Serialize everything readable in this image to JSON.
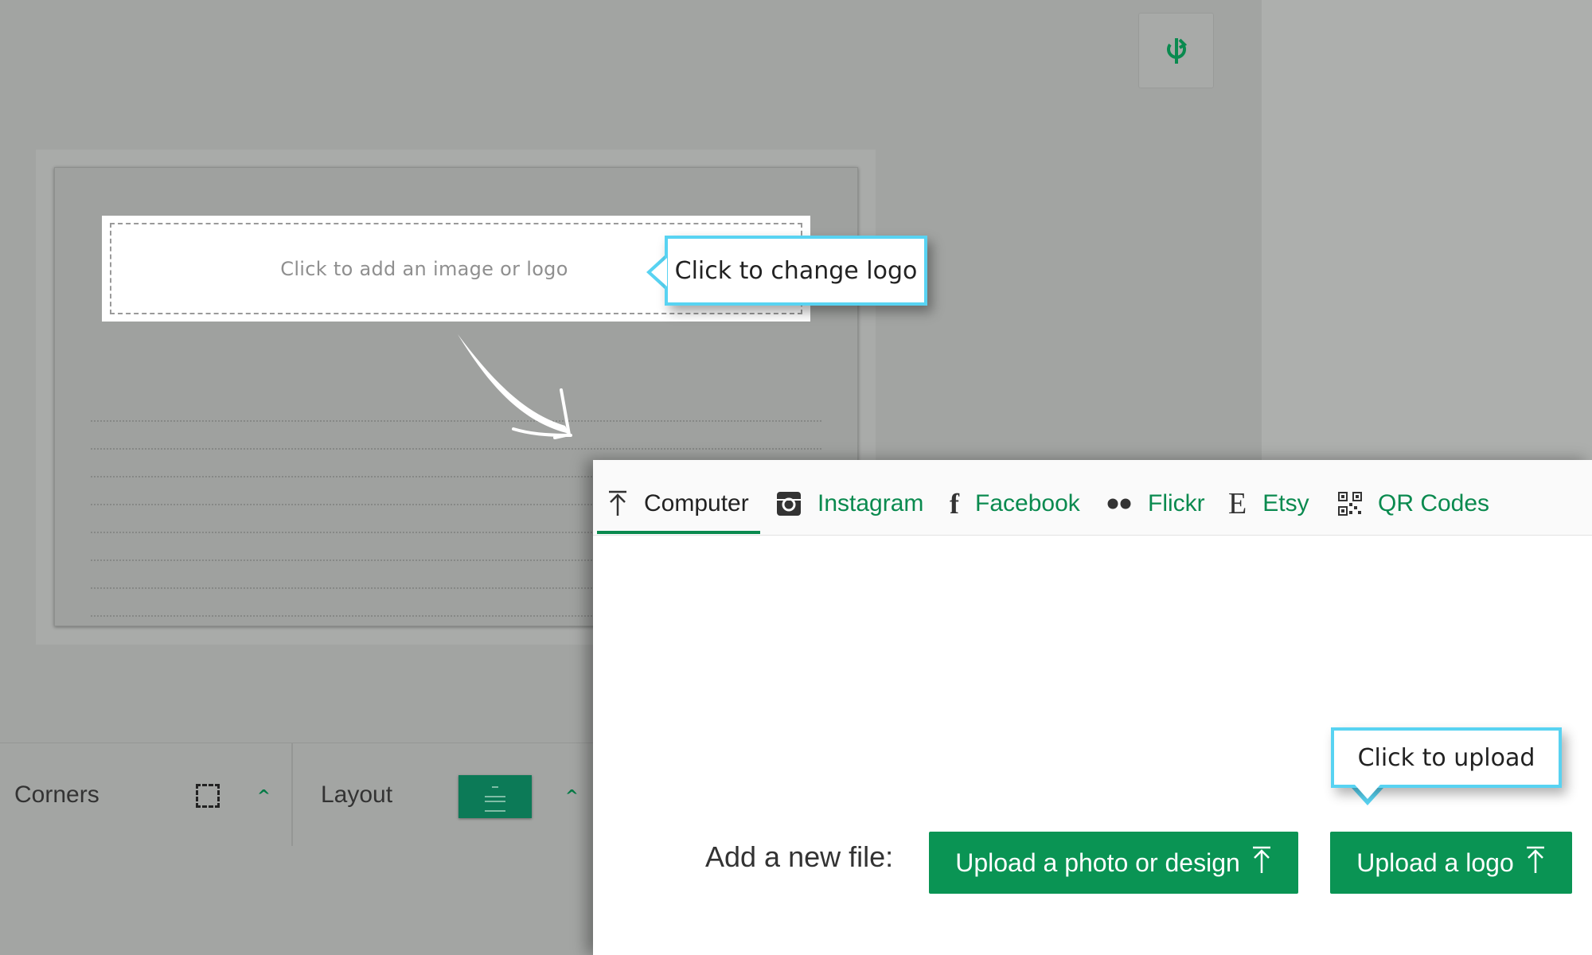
{
  "canvas": {
    "logo_placeholder": "Click to add an image or logo"
  },
  "tooltips": {
    "change_logo": "Click to change logo",
    "upload": "Click to upload"
  },
  "toolbar": {
    "corners_label": "Corners",
    "layout_label": "Layout"
  },
  "upload_dialog": {
    "tabs": [
      {
        "label": "Computer",
        "icon": "upload-arrow-icon",
        "active": true
      },
      {
        "label": "Instagram",
        "icon": "instagram-icon",
        "active": false
      },
      {
        "label": "Facebook",
        "icon": "facebook-icon",
        "active": false
      },
      {
        "label": "Flickr",
        "icon": "flickr-icon",
        "active": false
      },
      {
        "label": "Etsy",
        "icon": "etsy-icon",
        "active": false
      },
      {
        "label": "QR Codes",
        "icon": "qr-code-icon",
        "active": false
      }
    ],
    "add_new_file_label": "Add a new file:",
    "upload_photo_button": "Upload a photo or design",
    "upload_logo_button": "Upload a logo"
  },
  "colors": {
    "accent_green": "#0a9454",
    "tooltip_border": "#58d3f2",
    "overlay_gray": "#a2a4a2"
  }
}
